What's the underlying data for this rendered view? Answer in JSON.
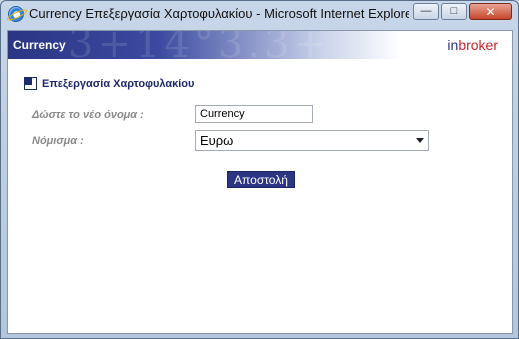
{
  "window": {
    "title": "Currency Επεξεργασία Χαρτοφυλακίου - Microsoft Internet Explorer ...",
    "minimize_glyph": "—",
    "maximize_glyph": "□",
    "close_glyph": "✕"
  },
  "banner": {
    "title": "Currency",
    "brand_in": "in",
    "brand_broker": "broker",
    "pattern": "3+14°3.3+"
  },
  "form": {
    "section_title": "Επεξεργασία Χαρτοφυλακίου",
    "name_label": "Δώστε το νέο όνομα :",
    "name_value": "Currency",
    "currency_label": "Νόμισμα :",
    "currency_selected": "Ευρω",
    "submit_label": "Αποστολή"
  },
  "colors": {
    "banner_dark": "#2b3584",
    "brand_red": "#d2232a",
    "section_title": "#1d2a6b"
  },
  "icons": {
    "app": "internet-explorer-icon",
    "section": "section-square-icon",
    "dropdown": "chevron-down-icon"
  }
}
